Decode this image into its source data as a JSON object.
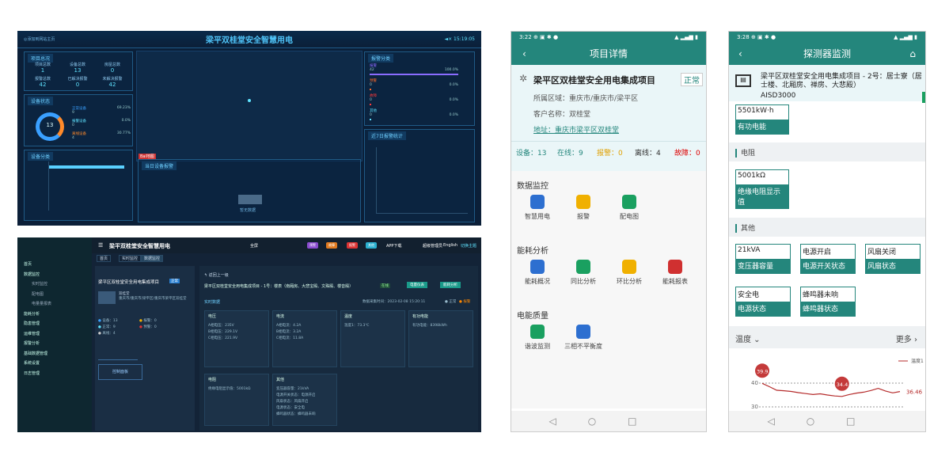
{
  "dash": {
    "title": "梁平双桂堂安全智慧用电",
    "left_top": "◎添加到网站主页",
    "time": "15:19:05",
    "stats_title": "项目总况",
    "stats": [
      {
        "l": "项目总数",
        "v": "1"
      },
      {
        "l": "设备总数",
        "v": "13"
      },
      {
        "l": "房屋总数",
        "v": "0"
      },
      {
        "l": "报警总数",
        "v": "42"
      },
      {
        "l": "已解决报警",
        "v": "0"
      },
      {
        "l": "未解决报警",
        "v": "42"
      }
    ],
    "status_title": "设备状态",
    "donut": "13",
    "status_rows": [
      {
        "l": "正常设备",
        "n": "9",
        "p": "69.23%"
      },
      {
        "l": "报警设备",
        "n": "0",
        "p": "0.0%"
      },
      {
        "l": "离线设备",
        "n": "4",
        "p": "30.77%"
      }
    ],
    "cat_title": "设备分类",
    "alarm_title": "报警分类",
    "alarm_rows": [
      {
        "l": "报警",
        "n": "42",
        "p": "100.0%"
      },
      {
        "l": "预警",
        "n": "0",
        "p": "0.0%"
      },
      {
        "l": "故障",
        "n": "0",
        "p": "0.0%"
      },
      {
        "l": "其他",
        "n": "0",
        "p": "0.0%"
      }
    ],
    "trend_title": "近7日报警统计",
    "center_title": "当日设备报警",
    "center_sub": "暂无数据",
    "baidu": "Bai地图"
  },
  "adm": {
    "title": "梁平双桂堂安全智慧用电",
    "full": "全屏",
    "app": "APP下载",
    "user": "超级管理员",
    "lang": "English",
    "switch": "切换主题",
    "menu": [
      "首页",
      "数据监控",
      "实时监控",
      "配电图",
      "电量量报表",
      "能耗分析",
      "隐患管理",
      "运维管理",
      "报警分析",
      "基础数据管理",
      "系统设置",
      "日志管理"
    ],
    "tabs": [
      "首页",
      "实时监控",
      "数据监控"
    ],
    "proj": "梁平区双桂堂安全用电集成项目",
    "proj_tag": "正常",
    "addr": "重庆市/重庆市/梁平区/重庆市梁平区双桂堂",
    "addr_name": "双桂堂",
    "dev": "梁平区双桂堂安全用电集成项目 - 1号：楼表（南厢房、大悲宝殿、文殊殿、楼音殿）",
    "online": "在线",
    "back": "返回上一级",
    "btn1": "电量仪表",
    "btn2": "能耗分析",
    "rt": "实时数据",
    "updated": "数据采集时间：2023-02-08 15:20:11",
    "legend": [
      "正常",
      "报警"
    ],
    "counts": [
      {
        "l": "设备",
        "v": "13"
      },
      {
        "l": "正常",
        "v": "9"
      },
      {
        "l": "离线",
        "v": "4"
      },
      {
        "l": "报警",
        "v": "0"
      },
      {
        "l": "预警",
        "v": "0"
      }
    ],
    "cards": [
      {
        "h": "电压",
        "l": [
          "A相电压：235V",
          "B相电压：229.1V",
          "C相电压：221.9V"
        ]
      },
      {
        "h": "电流",
        "l": [
          "A相电流：4.2A",
          "B相电流：3.2A",
          "C相电流：11.8A"
        ]
      },
      {
        "h": "温度",
        "l": [
          "温度1：73.3℃"
        ]
      },
      {
        "h": "有功电能",
        "l": [
          "有功电能：8398kWh"
        ]
      },
      {
        "h": "电阻",
        "l": [
          "绝缘电阻显示值：5001kΩ"
        ]
      },
      {
        "h": "其他",
        "l": [
          "变压器容量：21kVA",
          "电源开关状态：电源开启",
          "风扇状态：风扇开启",
          "电源状态：安全电",
          "蜂鸣器状态：蜂鸣器未响"
        ]
      }
    ],
    "ctrl": "控制面板"
  },
  "p1": {
    "time": "3:22",
    "title": "项目详情",
    "proj": "梁平区双桂堂安全用电集成项目",
    "tag": "正常",
    "area": "所属区域：重庆市/重庆市/梁平区",
    "cust": "客户名称：双桂堂",
    "addr": "地址：重庆市梁平区双桂堂",
    "sum": [
      {
        "t": "设备：13",
        "c": "#24867c"
      },
      {
        "t": "在线：9",
        "c": "#24867c"
      },
      {
        "t": "报警：0",
        "c": "#e0a000"
      },
      {
        "t": "离线：4",
        "c": "#333"
      },
      {
        "t": "故障：0",
        "c": "#d00"
      }
    ],
    "s1": "数据监控",
    "i1": [
      {
        "l": "智慧用电",
        "c": "#2d6fd0"
      },
      {
        "l": "报警",
        "c": "#f0b000"
      },
      {
        "l": "配电图",
        "c": "#1aa060"
      }
    ],
    "s2": "能耗分析",
    "i2": [
      {
        "l": "能耗概况",
        "c": "#2d6fd0"
      },
      {
        "l": "同比分析",
        "c": "#1aa060"
      },
      {
        "l": "环比分析",
        "c": "#f0b000"
      },
      {
        "l": "能耗报表",
        "c": "#d03030"
      }
    ],
    "s3": "电能质量",
    "i3": [
      {
        "l": "谐波监测",
        "c": "#1aa060"
      },
      {
        "l": "三相不平衡度",
        "c": "#2d6fd0"
      }
    ]
  },
  "p2": {
    "time": "3:28",
    "title": "探测器监测",
    "dev": "梁平区双桂堂安全用电集成项目 - 2号：居士寮（居士楼、北厢房、禅房、大悲殿）",
    "code": "AISD3000",
    "energy": {
      "v": "5501kW·h",
      "n": "有功电能"
    },
    "g_res": "电阻",
    "res": {
      "v": "5001kΩ",
      "n": "绝缘电阻显示值"
    },
    "g_other": "其他",
    "other": [
      {
        "v": "21kVA",
        "n": "变压器容量"
      },
      {
        "v": "电源开启",
        "n": "电源开关状态"
      },
      {
        "v": "风扇关闭",
        "n": "风扇状态"
      },
      {
        "v": "安全电",
        "n": "电源状态"
      },
      {
        "v": "蜂鸣器未响",
        "n": "蜂鸣器状态"
      }
    ],
    "temp": "温度",
    "more": "更多",
    "legend": "温度1",
    "pin1": "39.9",
    "pin2": "34.4",
    "last": "36.46",
    "yt": [
      "40",
      "30"
    ],
    "series": [
      39.9,
      38.5,
      37.0,
      36.8,
      36.5,
      36.0,
      35.6,
      35.2,
      35.5,
      35.0,
      34.6,
      34.4,
      35.2,
      35.8,
      36.2,
      36.9,
      37.8,
      36.7,
      35.9,
      36.46
    ]
  }
}
